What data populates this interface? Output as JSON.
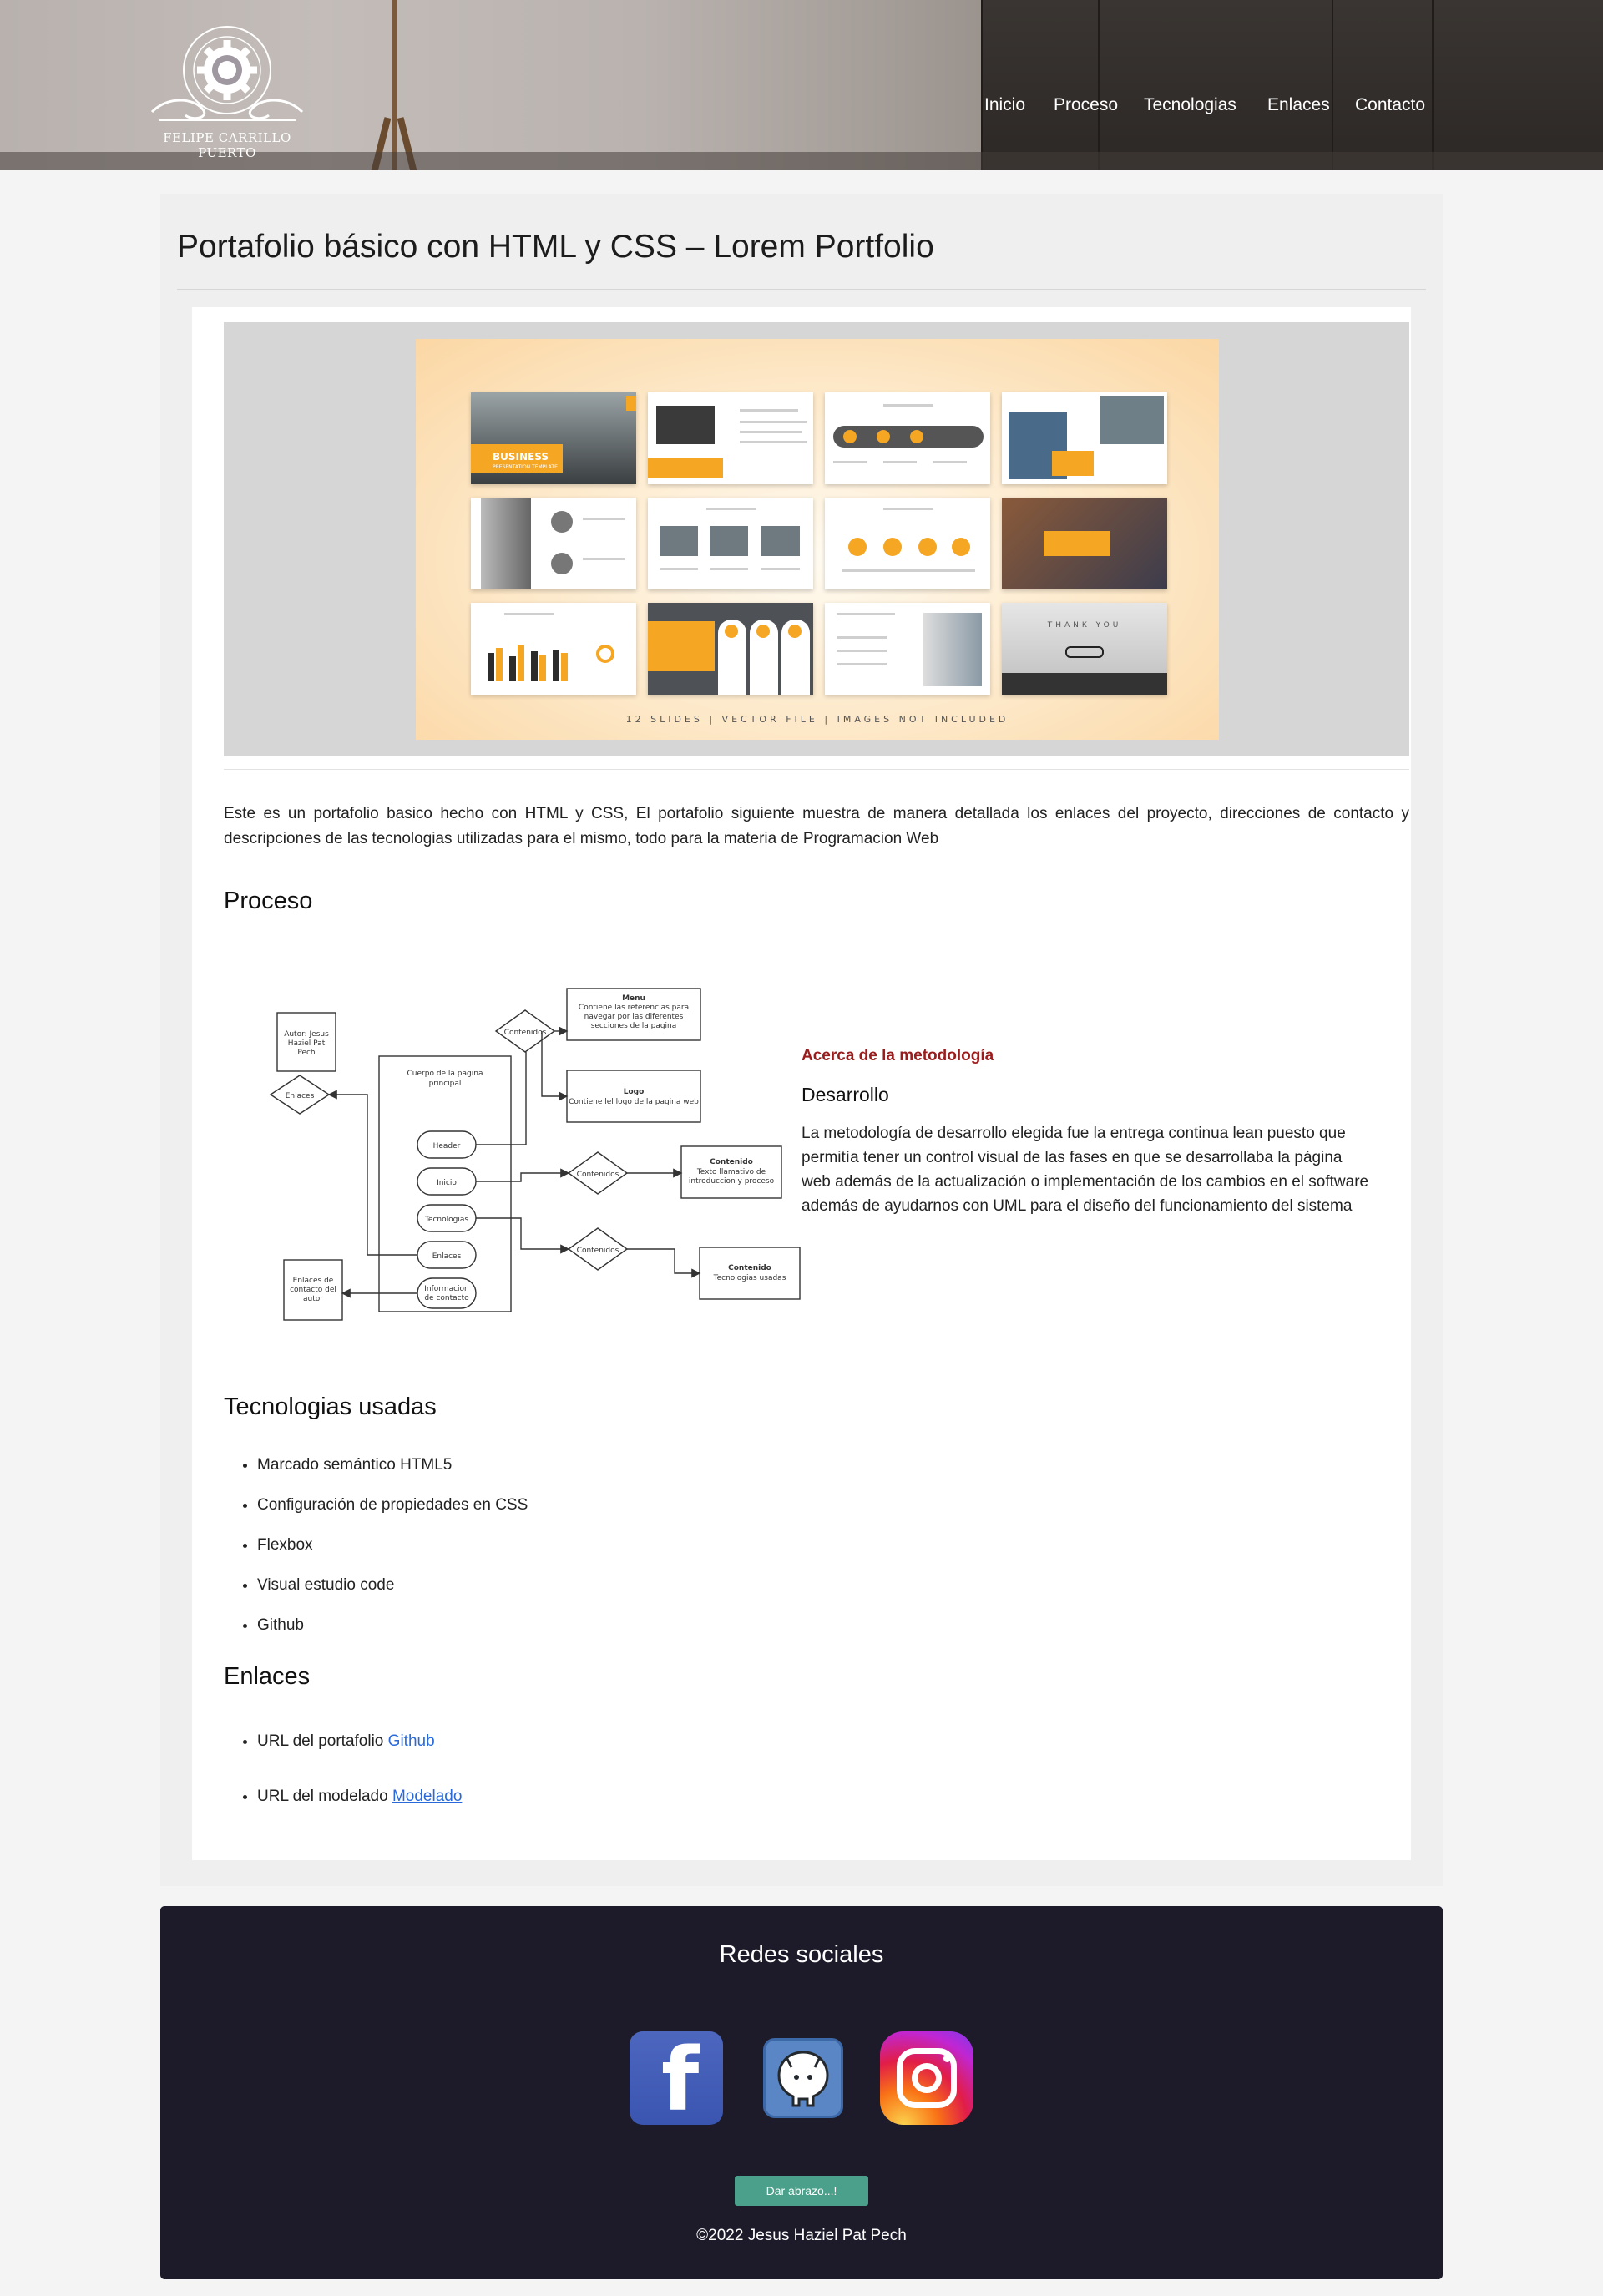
{
  "header": {
    "logo_caption": "Felipe Carrillo Puerto",
    "nav": [
      "Inicio",
      "Proceso",
      "Tecnologias",
      "Enlaces",
      "Contacto"
    ]
  },
  "main": {
    "title": "Portafolio básico con HTML y CSS – Lorem Portfolio",
    "banner": {
      "slide_title": "BUSINESS",
      "slide_subtitle": "PRESENTATION TEMPLATE",
      "thank_you": "THANK YOU",
      "footer": "12 SLIDES | VECTOR FILE | IMAGES NOT INCLUDED"
    },
    "intro": "Este es un portafolio basico hecho con HTML y CSS, El portafolio siguiente muestra de manera detallada los enlaces del proyecto, direcciones de contacto y descripciones de las tecnologias utilizadas para el mismo, todo para la materia de Programacion Web",
    "proceso_heading": "Proceso",
    "diagram": {
      "autor": [
        "Autor: Jesus",
        "Haziel Pat",
        "Pech"
      ],
      "cuerpo": [
        "Cuerpo de la pagina",
        "principal"
      ],
      "header": "Header",
      "inicio": "Inicio",
      "tecnologias": "Tecnologias",
      "enlaces": "Enlaces",
      "informacion": [
        "Informacion",
        "de contacto"
      ],
      "enlaces_diamond": "Enlaces",
      "enlaces_autor": [
        "Enlaces de",
        "contacto del",
        "autor"
      ],
      "contenidos": "Contenidos",
      "menu_title": "Menu",
      "menu_text": [
        "Contiene las referencias para",
        "navegar por las diferentes",
        "secciones de la pagina"
      ],
      "logo_title": "Logo",
      "logo_text": "Contiene lel logo de la pagina web",
      "contenido_title": "Contenido",
      "contenido1_text": [
        "Texto llamativo de",
        "introduccion y proceso"
      ],
      "contenido2_text": "Tecnologias usadas"
    },
    "metodologia": {
      "tag": "Acerca de la metodología",
      "subtitle": "Desarrollo",
      "body": "La metodología de desarrollo elegida fue la entrega continua lean puesto que permitía tener un control visual de las fases en que se desarrollaba la página web además de la actualización o implementación de los cambios en el software además de ayudarnos con UML para el diseño del funcionamiento del sistema"
    },
    "tecnologias_heading": "Tecnologias usadas",
    "tecnologias": [
      "Marcado semántico HTML5",
      "Configuración de propiedades en CSS",
      "Flexbox",
      "Visual estudio code",
      "Github"
    ],
    "enlaces_heading": "Enlaces",
    "enlaces": [
      {
        "prefix": "URL del portafolio ",
        "link": "Github"
      },
      {
        "prefix": "URL del modelado ",
        "link": "Modelado"
      }
    ]
  },
  "footer": {
    "title": "Redes sociales",
    "social": [
      "facebook-icon",
      "github-icon",
      "instagram-icon"
    ],
    "button": "Dar abrazo...!",
    "copyright": "©2022 Jesus Haziel Pat Pech"
  },
  "colors": {
    "accent": "#f5a623",
    "footer_bg": "#1d1b2a",
    "button": "#4aa08a",
    "tag": "#9b1c1c",
    "link": "#2a6ad8"
  }
}
